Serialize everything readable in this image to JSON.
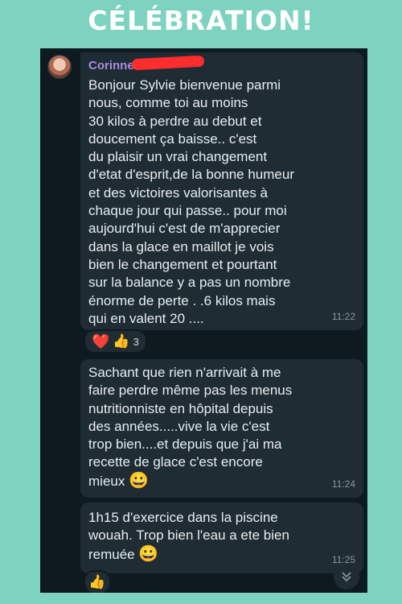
{
  "banner": {
    "title": "CÉLÉBRATION!"
  },
  "chat": {
    "messages": [
      {
        "sender": "Corinne",
        "text": "Bonjour Sylvie bienvenue parmi\nnous, comme toi au moins\n30 kilos à perdre au debut et\ndoucement ça baisse..   c'est\ndu plaisir un vrai changement\nd'etat d'esprit,de la bonne humeur\net des victoires valorisantes à\nchaque jour qui passe..  pour moi\naujourd'hui c'est de m'apprecier\ndans la glace en maillot je vois\nbien le changement et pourtant\nsur la balance y a pas un nombre\nénorme de perte . .6 kilos mais\nqui en valent 20 ....",
        "time": "11:22",
        "reactions": {
          "heart": "❤️",
          "thumbs_up": "👍",
          "count": "3"
        }
      },
      {
        "text": "Sachant que rien n'arrivait à me\nfaire perdre même pas les menus\nnutritionniste en hôpital depuis\ndes années.....vive la vie c'est\ntrop bien....et depuis que j'ai ma\nrecette de glace c'est encore\nmieux",
        "emoji": "😀",
        "time": "11:24"
      },
      {
        "text": "1h15 d'exercice dans la piscine\nwouah.   Trop bien l'eau a ete bien\nremuée",
        "emoji": "😀",
        "time": "11:25",
        "reaction": "👍"
      }
    ]
  },
  "colors": {
    "banner_bg": "#7dd3bf",
    "chat_bg": "#0e1a1f",
    "bubble_bg": "#1f2c33",
    "sender": "#a88de4"
  },
  "icons": {
    "scroll_down": "chevron-double-down-icon"
  }
}
